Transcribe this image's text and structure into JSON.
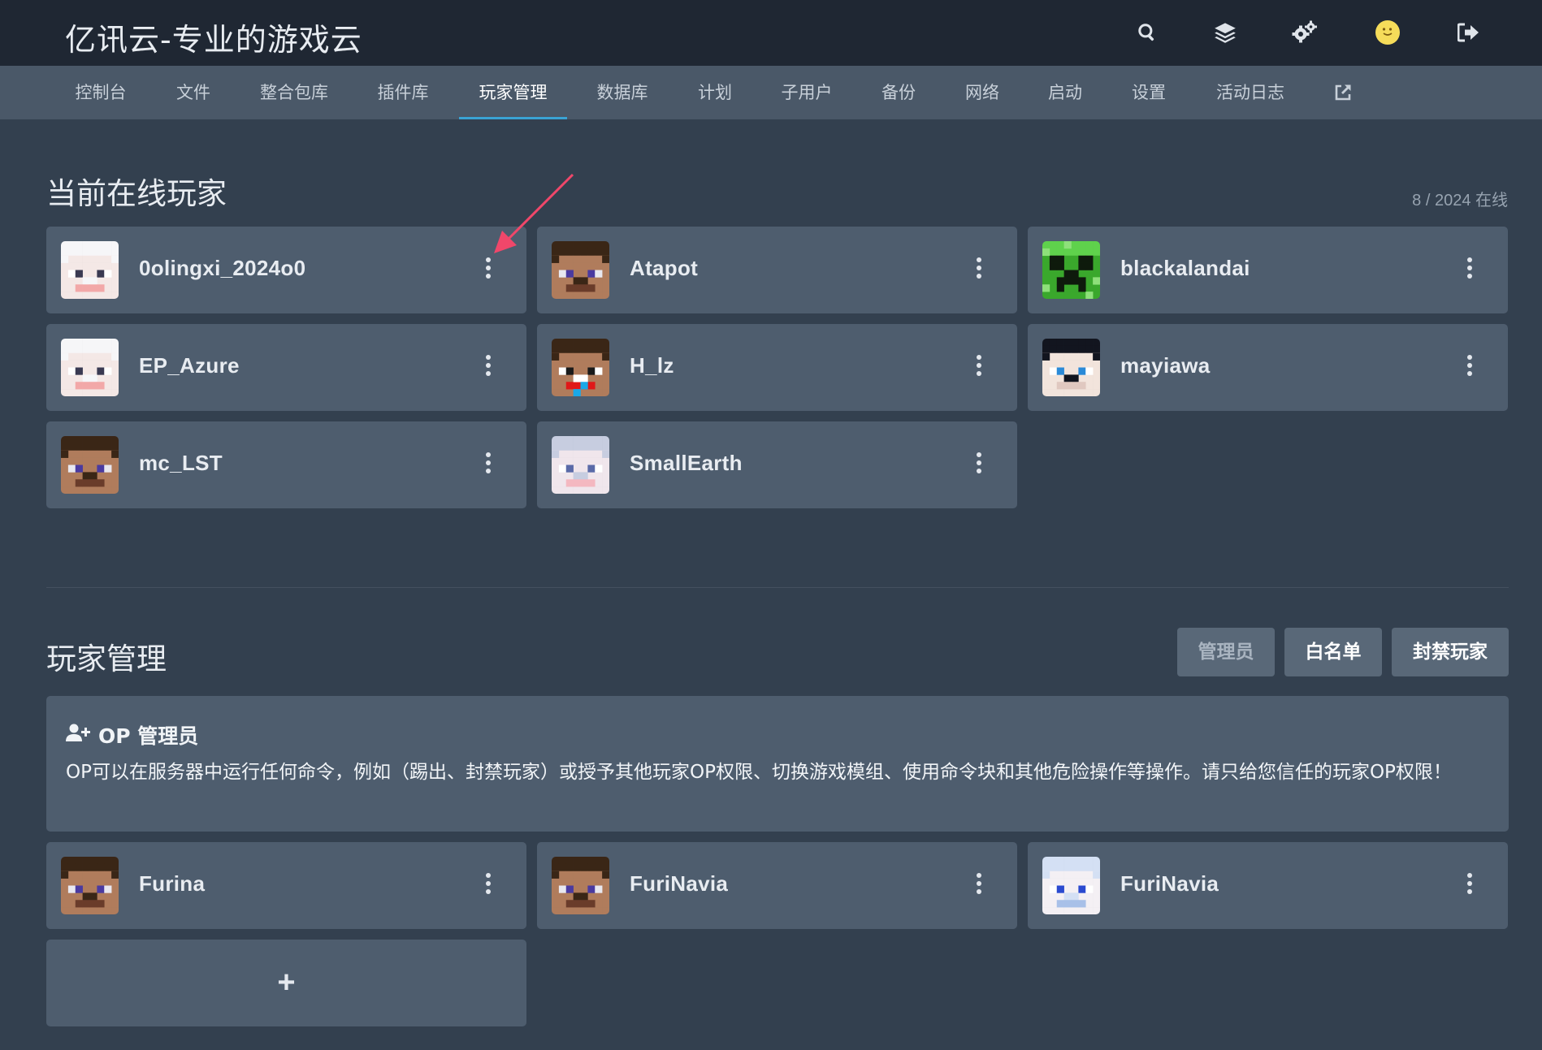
{
  "app": {
    "title": "亿讯云-专业的游戏云"
  },
  "topbar_icons": [
    "search-icon",
    "layers-icon",
    "cogs-icon",
    "avatar-icon",
    "logout-icon"
  ],
  "nav": {
    "items": [
      "控制台",
      "文件",
      "整合包库",
      "插件库",
      "玩家管理",
      "数据库",
      "计划",
      "子用户",
      "备份",
      "网络",
      "启动",
      "设置",
      "活动日志"
    ],
    "active": "玩家管理",
    "external_icon": "external-link-icon"
  },
  "online": {
    "title": "当前在线玩家",
    "count": "8 / 2024 在线",
    "players": [
      {
        "name": "0olingxi_2024o0",
        "avatar": "white-hair"
      },
      {
        "name": "Atapot",
        "avatar": "steve"
      },
      {
        "name": "blackalandai",
        "avatar": "creeper"
      },
      {
        "name": "EP_Azure",
        "avatar": "white-hair"
      },
      {
        "name": "H_lz",
        "avatar": "derp"
      },
      {
        "name": "mayiawa",
        "avatar": "dark-hair"
      },
      {
        "name": "mc_LST",
        "avatar": "steve"
      },
      {
        "name": "SmallEarth",
        "avatar": "silver-hair"
      }
    ]
  },
  "management": {
    "title": "玩家管理",
    "tabs": [
      "管理员",
      "白名单",
      "封禁玩家"
    ],
    "op": {
      "heading": "OP 管理员",
      "description": "OP可以在服务器中运行任何命令，例如（踢出、封禁玩家）或授予其他玩家OP权限、切换游戏模组、使用命令块和其他危险操作等操作。请只给您信任的玩家OP权限！"
    },
    "op_players": [
      {
        "name": "Furina",
        "avatar": "steve"
      },
      {
        "name": "FuriNavia",
        "avatar": "steve"
      },
      {
        "name": "FuriNavia",
        "avatar": "blue-white"
      }
    ],
    "add_label": "+"
  },
  "colors": {
    "accent": "#3aa3d4",
    "annotation_arrow": "#f0476a"
  }
}
